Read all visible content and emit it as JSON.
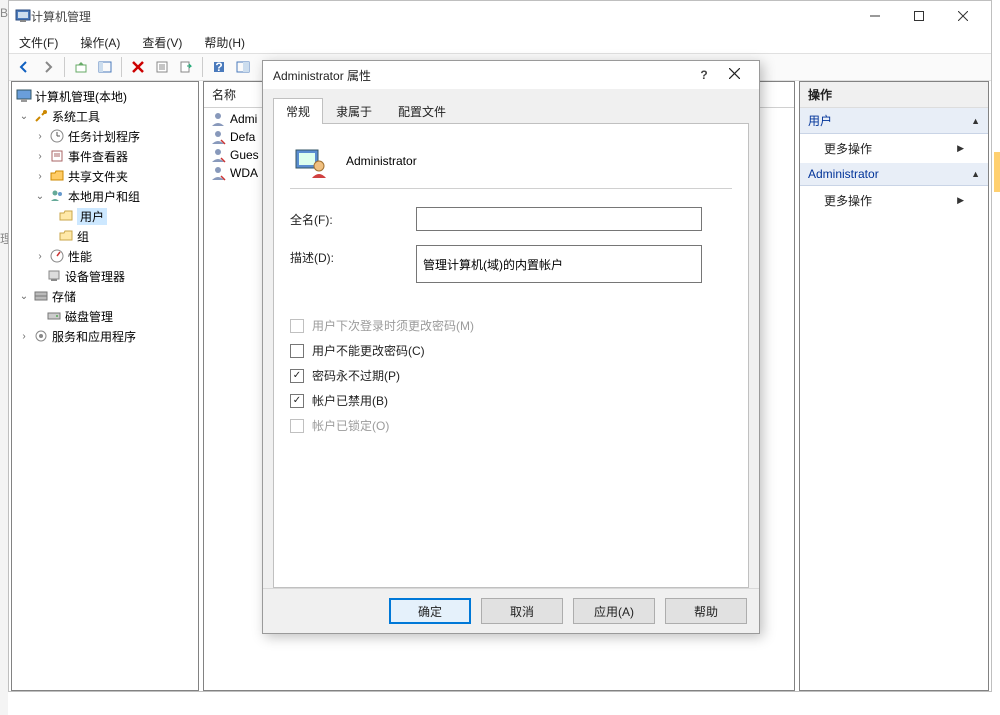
{
  "window": {
    "title": "计算机管理",
    "menu": {
      "file": "文件(F)",
      "action": "操作(A)",
      "view": "查看(V)",
      "help": "帮助(H)"
    }
  },
  "tree": {
    "root": "计算机管理(本地)",
    "systools": "系统工具",
    "task": "任务计划程序",
    "event": "事件查看器",
    "shared": "共享文件夹",
    "localusers": "本地用户和组",
    "users": "用户",
    "groups": "组",
    "perf": "性能",
    "devmgr": "设备管理器",
    "storage": "存储",
    "diskmgr": "磁盘管理",
    "services": "服务和应用程序"
  },
  "list": {
    "header_name": "名称",
    "rows": [
      "Admi",
      "Defa",
      "Gues",
      "WDA"
    ]
  },
  "actions": {
    "title": "操作",
    "sec1": "用户",
    "more": "更多操作",
    "sec2": "Administrator"
  },
  "dialog": {
    "title": "Administrator 属性",
    "tabs": {
      "general": "常规",
      "member": "隶属于",
      "profile": "配置文件"
    },
    "username": "Administrator",
    "fullname_label": "全名(F):",
    "fullname_value": "",
    "desc_label": "描述(D):",
    "desc_value": "管理计算机(域)的内置帐户",
    "chk_nextlogin": "用户下次登录时须更改密码(M)",
    "chk_nochange": "用户不能更改密码(C)",
    "chk_neverexp": "密码永不过期(P)",
    "chk_disabled": "帐户已禁用(B)",
    "chk_locked": "帐户已锁定(O)",
    "checks": {
      "nextlogin": false,
      "nochange": false,
      "neverexp": true,
      "disabled": true,
      "locked": false
    },
    "buttons": {
      "ok": "确定",
      "cancel": "取消",
      "apply": "应用(A)",
      "help": "帮助"
    }
  }
}
